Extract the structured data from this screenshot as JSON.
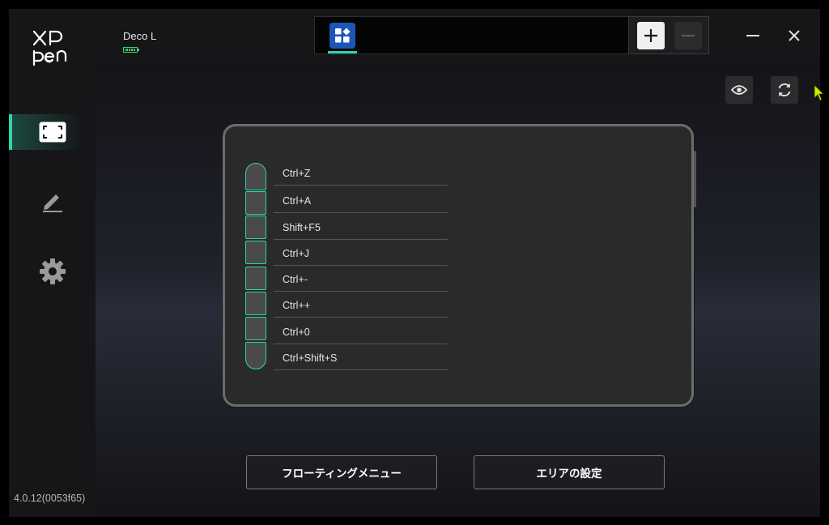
{
  "device": {
    "name": "Deco L",
    "battery_level": 1.0
  },
  "version": "4.0.12(0053f65)",
  "sidebar": {
    "items": [
      {
        "name": "work-area",
        "icon": "fullscreen-frame-icon",
        "active": true
      },
      {
        "name": "pen",
        "icon": "pen-icon",
        "active": false
      },
      {
        "name": "settings",
        "icon": "gear-icon",
        "active": false
      }
    ]
  },
  "app_tabs": [
    {
      "icon": "all-apps-grid-icon",
      "active": true
    }
  ],
  "shortcut_keys": [
    {
      "label": "Ctrl+Z"
    },
    {
      "label": "Ctrl+A"
    },
    {
      "label": "Shift+F5"
    },
    {
      "label": "Ctrl+J"
    },
    {
      "label": "Ctrl+-"
    },
    {
      "label": "Ctrl++"
    },
    {
      "label": "Ctrl+0"
    },
    {
      "label": "Ctrl+Shift+S"
    }
  ],
  "buttons": {
    "floating_menu": "フローティングメニュー",
    "area_settings": "エリアの設定"
  },
  "colors": {
    "accent": "#2bd4ad",
    "battery": "#3ad46a",
    "app_tab": "#1d56b8",
    "cursor": "#c8f000"
  }
}
